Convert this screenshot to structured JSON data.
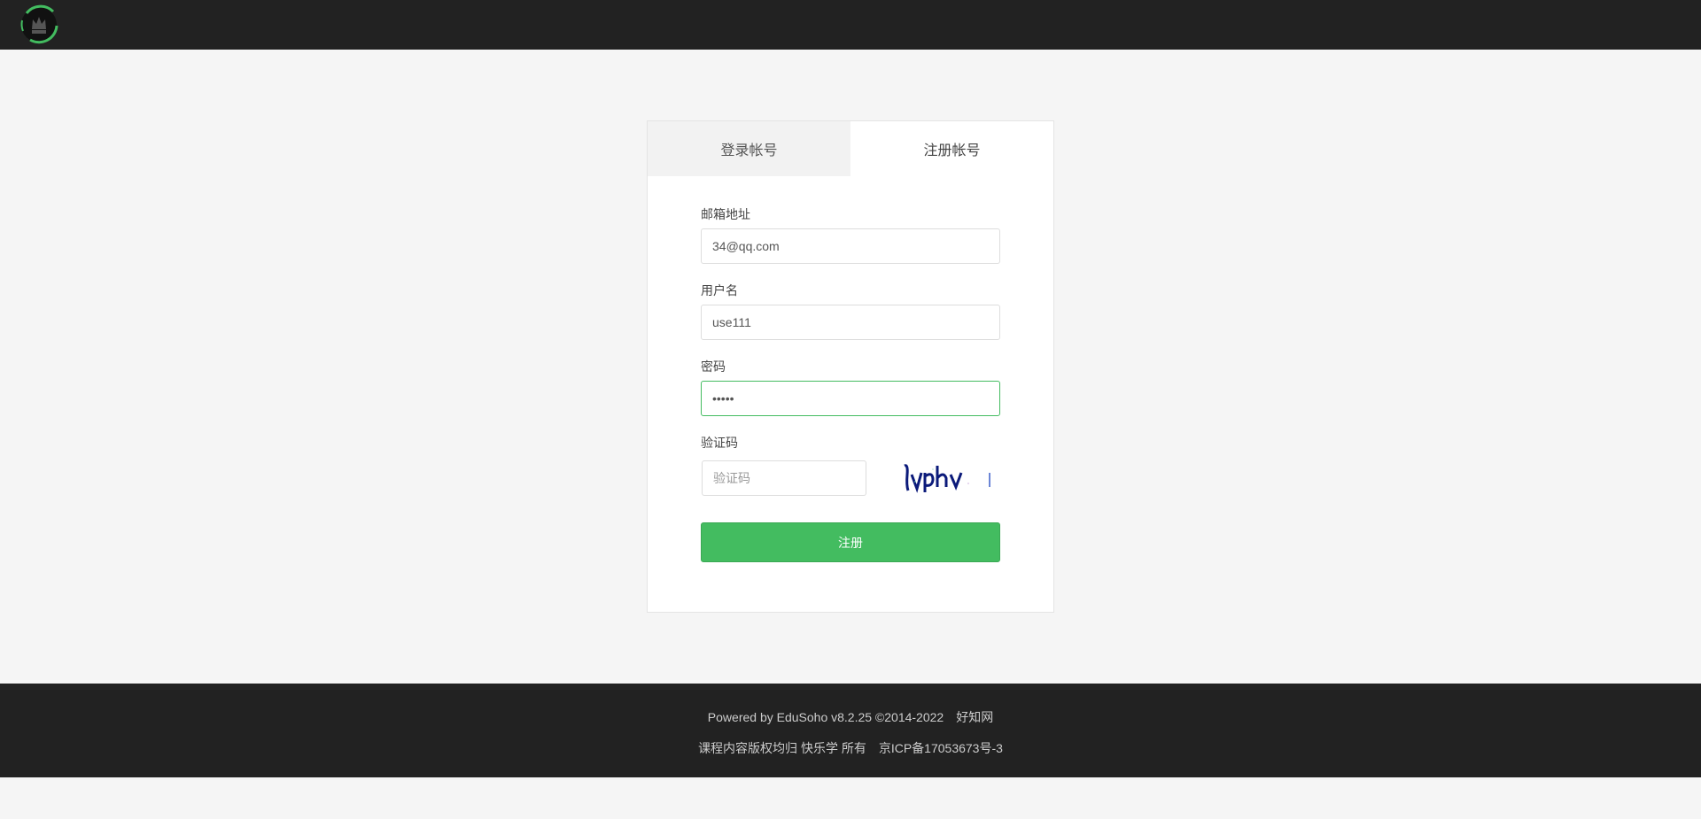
{
  "header": {
    "logo_icon": "crown-logo-icon"
  },
  "tabs": [
    {
      "label": "登录帐号",
      "active": false
    },
    {
      "label": "注册帐号",
      "active": true
    }
  ],
  "form": {
    "email": {
      "label": "邮箱地址",
      "value": "34@qq.com"
    },
    "username": {
      "label": "用户名",
      "value": "use111"
    },
    "password": {
      "label": "密码",
      "value": "•••••"
    },
    "captcha": {
      "label": "验证码",
      "placeholder": "验证码",
      "image_text": "Lvphv"
    },
    "submit_label": "注册"
  },
  "footer": {
    "powered": "Powered by EduSoho v8.2.25 ©2014-2022",
    "powered_link": "好知网",
    "copyright": "课程内容版权均归 快乐学 所有",
    "icp": "京ICP备17053673号-3"
  },
  "colors": {
    "accent": "#43bc60",
    "topbar": "#222222",
    "background": "#f5f5f5"
  }
}
